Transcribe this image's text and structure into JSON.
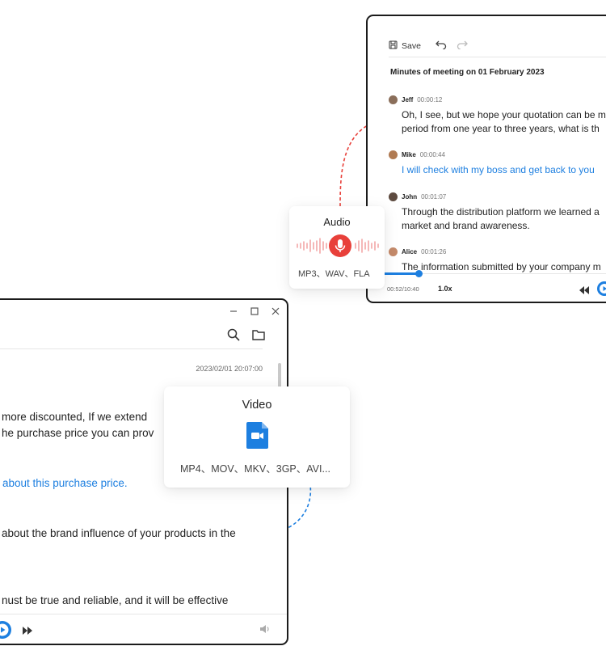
{
  "right_window": {
    "toolbar": {
      "save_label": "Save"
    },
    "minutes_title": "Minutes of meeting on 01 February 2023",
    "segments": [
      {
        "speaker": "Jeff",
        "time": "00:00:12",
        "lines": [
          "Oh, I see, but we hope your quotation can be m",
          "period from one year to three years, what is th"
        ],
        "highlight": false
      },
      {
        "speaker": "Mike",
        "time": "00:00:44",
        "lines": [
          "I will check with my boss and get back to you"
        ],
        "highlight": true
      },
      {
        "speaker": "John",
        "time": "00:01:07",
        "lines": [
          "Through the distribution platform we learned a",
          "market and brand awareness."
        ],
        "highlight": false
      },
      {
        "speaker": "Alice",
        "time": "00:01:26",
        "lines": [
          "The information submitted by your company m"
        ],
        "highlight": false
      }
    ],
    "player": {
      "time": "00:52/10:40",
      "speed": "1.0x",
      "progress_fraction": 0.08
    }
  },
  "left_window": {
    "timestamp": "2023/02/01 20:07:00",
    "lines": [
      "more discounted,  If we extend",
      "he purchase price you can prov",
      "about this purchase price.",
      "about the brand influence of your products in the",
      "nust be true and reliable, and it will be effective"
    ]
  },
  "audio_card": {
    "title": "Audio",
    "formats": "MP3、WAV、FLA"
  },
  "video_card": {
    "title": "Video",
    "formats": "MP4、MOV、MKV、3GP、AVI..."
  },
  "colors": {
    "accent": "#1d7fe0",
    "audio_red": "#e8403a",
    "border": "#1b1b1b"
  },
  "icons": [
    "save-icon",
    "undo-icon",
    "redo-icon",
    "rewind-icon",
    "play-icon",
    "fast-forward-icon",
    "search-icon",
    "folder-icon",
    "minimize-icon",
    "maximize-icon",
    "close-icon",
    "volume-icon",
    "microphone-icon",
    "video-file-icon"
  ]
}
